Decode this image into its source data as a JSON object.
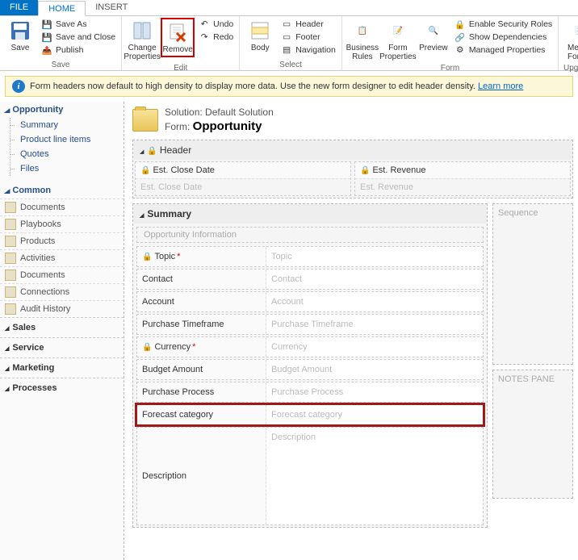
{
  "tabs": {
    "file": "FILE",
    "home": "HOME",
    "insert": "INSERT"
  },
  "ribbon": {
    "save": {
      "save": "Save",
      "saveAs": "Save As",
      "saveClose": "Save and Close",
      "publish": "Publish",
      "group": "Save"
    },
    "edit": {
      "changeProps": "Change Properties",
      "remove": "Remove",
      "undo": "Undo",
      "redo": "Redo",
      "group": "Edit"
    },
    "select": {
      "body": "Body",
      "header": "Header",
      "footer": "Footer",
      "navigation": "Navigation",
      "group": "Select"
    },
    "form": {
      "bizRules": "Business Rules",
      "formProps": "Form Properties",
      "preview": "Preview",
      "enableSec": "Enable Security Roles",
      "showDeps": "Show Dependencies",
      "managedProps": "Managed Properties",
      "group": "Form"
    },
    "upgrade": {
      "merge": "Merge Forms",
      "group": "Upgrade"
    }
  },
  "infobar": {
    "text": "Form headers now default to high density to display more data. Use the new form designer to edit header density. ",
    "link": "Learn more"
  },
  "nav": {
    "opportunity": {
      "title": "Opportunity",
      "items": [
        "Summary",
        "Product line items",
        "Quotes",
        "Files"
      ]
    },
    "common": {
      "title": "Common",
      "items": [
        "Documents",
        "Playbooks",
        "Products",
        "Activities",
        "Documents",
        "Connections",
        "Audit History"
      ]
    },
    "sections": [
      "Sales",
      "Service",
      "Marketing",
      "Processes"
    ]
  },
  "solution": {
    "prefix": "Solution: ",
    "name": "Default Solution",
    "formPrefix": "Form: ",
    "formName": "Opportunity"
  },
  "header": {
    "title": "Header",
    "f1l": "Est. Close Date",
    "f1p": "Est. Close Date",
    "f2l": "Est. Revenue",
    "f2p": "Est. Revenue"
  },
  "summary": {
    "title": "Summary",
    "subtitle": "Opportunity Information",
    "fields": {
      "topic": {
        "l": "Topic",
        "p": "Topic",
        "req": true,
        "lock": true
      },
      "contact": {
        "l": "Contact",
        "p": "Contact"
      },
      "account": {
        "l": "Account",
        "p": "Account"
      },
      "timeframe": {
        "l": "Purchase Timeframe",
        "p": "Purchase Timeframe"
      },
      "currency": {
        "l": "Currency",
        "p": "Currency",
        "req": true,
        "lock": true
      },
      "budget": {
        "l": "Budget Amount",
        "p": "Budget Amount"
      },
      "process": {
        "l": "Purchase Process",
        "p": "Purchase Process"
      },
      "forecast": {
        "l": "Forecast category",
        "p": "Forecast category"
      },
      "desc": {
        "l": "Description",
        "p": "Description"
      }
    }
  },
  "aside": {
    "sequence": "Sequence",
    "notes": "NOTES PANE"
  }
}
